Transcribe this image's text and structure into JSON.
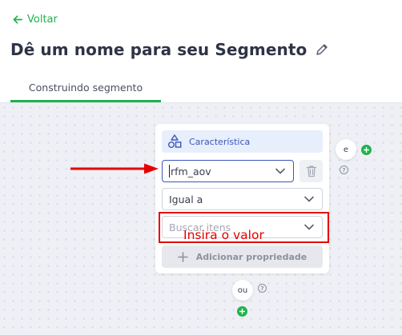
{
  "nav": {
    "back_label": "Voltar"
  },
  "header": {
    "title": "Dê um nome para seu Segmento"
  },
  "tabs": [
    {
      "label": "Construindo segmento",
      "active": true
    }
  ],
  "condition_card": {
    "characteristic_label": "Característica",
    "attribute": {
      "value": "rfm_aov"
    },
    "operator": {
      "value": "Igual a"
    },
    "value_field": {
      "placeholder": "Buscar itens"
    },
    "add_property_label": "Adicionar propriedade"
  },
  "logic": {
    "and_label": "e",
    "or_label": "ou"
  },
  "annotation": {
    "note": "Insira o valor"
  },
  "colors": {
    "accent": "#22b24c",
    "blue": "#3d56b8",
    "annotation": "#e60000"
  }
}
